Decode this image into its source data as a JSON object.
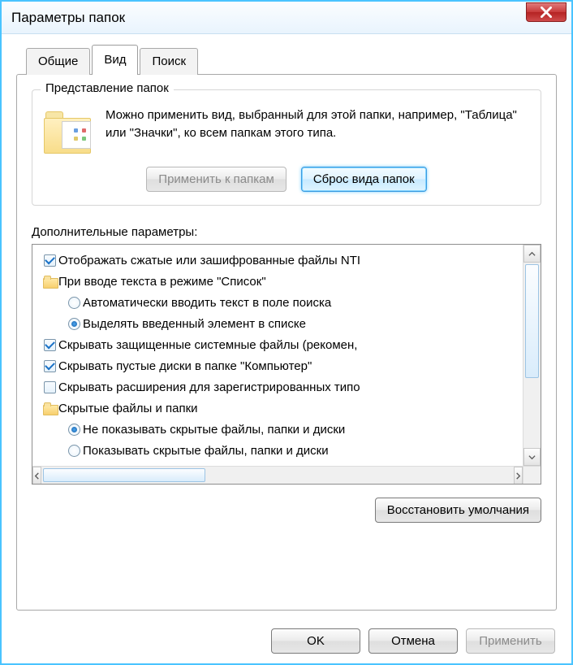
{
  "window": {
    "title": "Параметры папок"
  },
  "tabs": {
    "general": "Общие",
    "view": "Вид",
    "search": "Поиск"
  },
  "group": {
    "title": "Представление папок",
    "text": "Можно применить вид, выбранный для этой папки, например, \"Таблица\" или \"Значки\", ко всем папкам этого типа.",
    "apply": "Применить к папкам",
    "reset": "Сброс вида папок"
  },
  "advanced": {
    "label": "Дополнительные параметры:",
    "items": [
      {
        "type": "check",
        "checked": true,
        "indent": 0,
        "text": "Отображать сжатые или зашифрованные файлы NTI"
      },
      {
        "type": "folder",
        "checked": false,
        "indent": 0,
        "text": "При вводе текста в режиме \"Список\""
      },
      {
        "type": "radio",
        "checked": false,
        "indent": 1,
        "text": "Автоматически вводить текст в поле поиска"
      },
      {
        "type": "radio",
        "checked": true,
        "indent": 1,
        "text": "Выделять введенный элемент в списке"
      },
      {
        "type": "check",
        "checked": true,
        "indent": 0,
        "text": "Скрывать защищенные системные файлы (рекомен,"
      },
      {
        "type": "check",
        "checked": true,
        "indent": 0,
        "text": "Скрывать пустые диски в папке \"Компьютер\""
      },
      {
        "type": "check",
        "checked": false,
        "indent": 0,
        "text": "Скрывать расширения для зарегистрированных типо"
      },
      {
        "type": "folder",
        "checked": false,
        "indent": 0,
        "text": "Скрытые файлы и папки"
      },
      {
        "type": "radio",
        "checked": true,
        "indent": 1,
        "text": "Не показывать скрытые файлы, папки и диски"
      },
      {
        "type": "radio",
        "checked": false,
        "indent": 1,
        "text": "Показывать скрытые файлы, папки и диски"
      }
    ],
    "restore": "Восстановить умолчания"
  },
  "buttons": {
    "ok": "OK",
    "cancel": "Отмена",
    "apply": "Применить"
  }
}
